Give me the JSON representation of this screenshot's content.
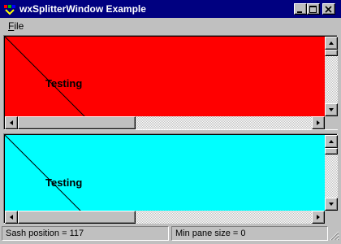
{
  "window": {
    "title": "wxSplitterWindow Example"
  },
  "menu": {
    "file_mnemonic": "F",
    "file_rest": "ile"
  },
  "panes": {
    "top": {
      "label": "Testing",
      "color": "#ff0000"
    },
    "bottom": {
      "label": "Testing",
      "color": "#00ffff"
    }
  },
  "statusbar": {
    "sash_position": "Sash position = 117",
    "min_pane_size": "Min pane size = 0"
  }
}
